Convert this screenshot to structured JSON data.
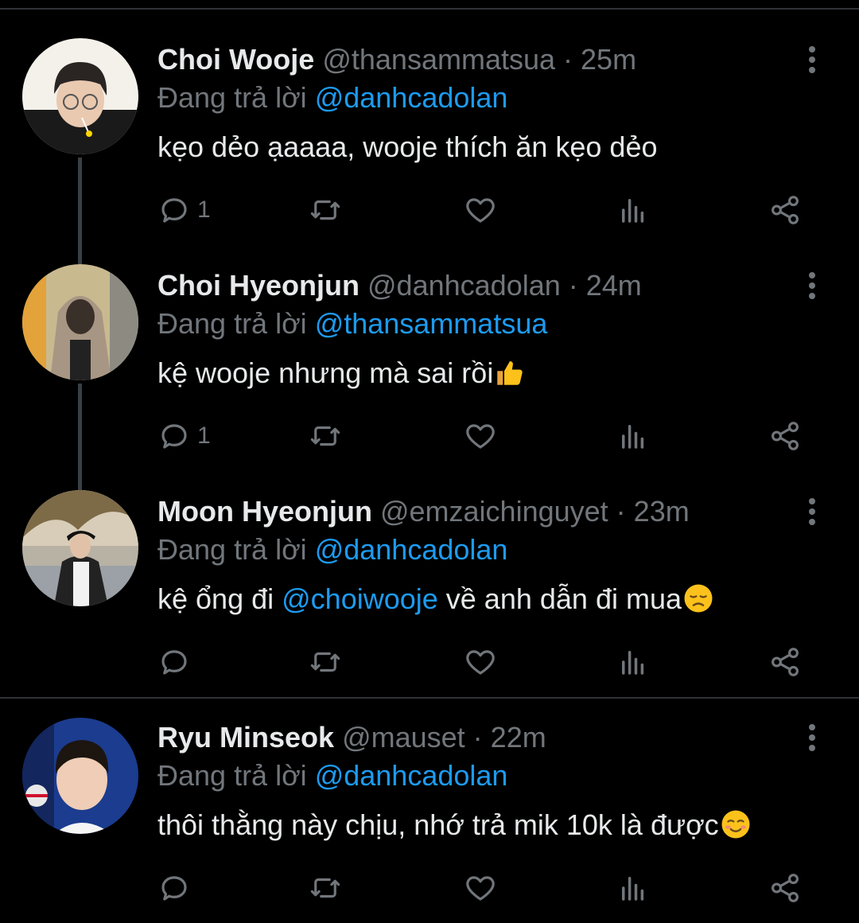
{
  "tweets": [
    {
      "name": "Choi Wooje",
      "handle": "@thansammatsua",
      "dot": " · ",
      "time": "25m",
      "reply_prefix": "Đang trả lời ",
      "reply_to": "@danhcadolan",
      "text": "kẹo dẻo ạaaaa, wooje thích ăn kẹo dẻo",
      "reply_count": "1"
    },
    {
      "name": "Choi Hyeonjun",
      "handle": "@danhcadolan",
      "dot": " · ",
      "time": "24m",
      "reply_prefix": "Đang trả lời ",
      "reply_to": "@thansammatsua",
      "text": "kệ wooje nhưng mà sai rồi",
      "emoji": "thumbs-up",
      "reply_count": "1"
    },
    {
      "name": "Moon Hyeonjun",
      "handle": "@emzaichinguyet",
      "dot": " · ",
      "time": "23m",
      "reply_prefix": "Đang trả lời ",
      "reply_to": "@danhcadolan",
      "text_before": "kệ ổng đi ",
      "mention": "@choiwooje",
      "text_after": " về anh dẫn đi mua",
      "emoji": "disappointed-face",
      "reply_count": ""
    },
    {
      "name": "Ryu Minseok",
      "handle": "@mauset",
      "dot": " · ",
      "time": "22m",
      "reply_prefix": "Đang trả lời ",
      "reply_to": "@danhcadolan",
      "text": "thôi thằng này chịu, nhớ trả mik 10k là được",
      "emoji": "smiling-face",
      "reply_count": ""
    }
  ],
  "icons": {
    "reply": "reply-icon",
    "retweet": "retweet-icon",
    "like": "like-icon",
    "views": "views-icon",
    "share": "share-icon",
    "more": "more-icon"
  },
  "colors": {
    "background": "#000000",
    "link": "#1d9bf0",
    "muted": "#71767b",
    "text": "#e7e9ea"
  }
}
